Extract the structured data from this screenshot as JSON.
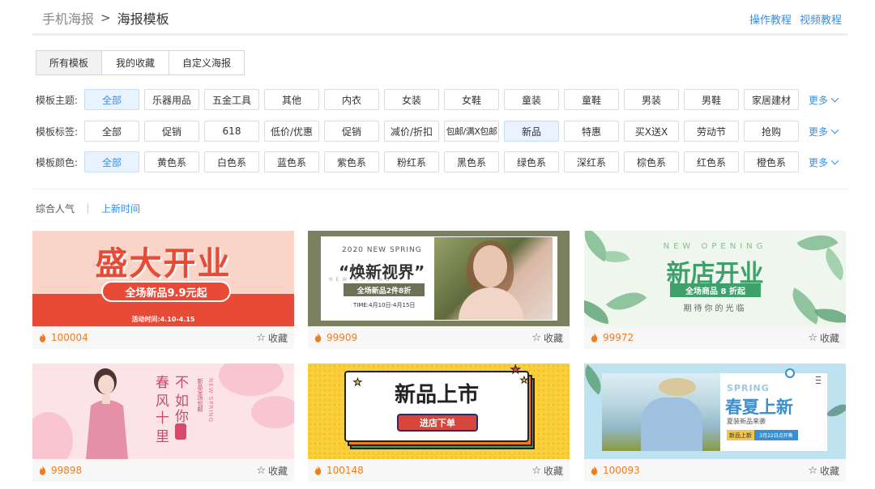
{
  "header": {
    "crumb_parent": "手机海报",
    "crumb_sep": ">",
    "crumb_current": "海报模板",
    "link_tutorial": "操作教程",
    "link_video": "视频教程"
  },
  "tabs": [
    {
      "label": "所有模板",
      "active": true
    },
    {
      "label": "我的收藏",
      "active": false
    },
    {
      "label": "自定义海报",
      "active": false
    }
  ],
  "filters": {
    "more_label": "更多",
    "theme": {
      "label": "模板主题:",
      "options": [
        "全部",
        "乐器用品",
        "五金工具",
        "其他",
        "内衣",
        "女装",
        "女鞋",
        "童装",
        "童鞋",
        "男装",
        "男鞋",
        "家居建材"
      ],
      "selected": "全部"
    },
    "tag": {
      "label": "模板标签:",
      "options": [
        "全部",
        "促销",
        "618",
        "低价/优惠",
        "促销",
        "减价/折扣",
        "包邮/满X包邮",
        "新品",
        "特惠",
        "买X送X",
        "劳动节",
        "抢购"
      ],
      "selected": "新品"
    },
    "color": {
      "label": "模板颜色:",
      "options": [
        "全部",
        "黄色系",
        "白色系",
        "蓝色系",
        "紫色系",
        "粉红系",
        "黑色系",
        "绿色系",
        "深红系",
        "棕色系",
        "红色系",
        "橙色系"
      ],
      "selected": "全部"
    }
  },
  "sort": {
    "popular": "综合人气",
    "newest": "上新时间"
  },
  "fav_label": "收藏",
  "cards": [
    {
      "count": "100004",
      "title": "盛大开业",
      "pill": "全场新品9.9元起",
      "small": "活动时间:4.10-4.15"
    },
    {
      "count": "99909",
      "en": "2020 NEW SPRING",
      "title": "“焕新视界”",
      "sub": "NEW SPRING",
      "badge": "全场新品2件8折",
      "time": "TIME:4月10日-4月15日"
    },
    {
      "count": "99972",
      "en": "NEW OPENING",
      "title": "新店开业",
      "badge": "全场商品 8 折起",
      "sub": "期待你的光临"
    },
    {
      "count": "99898",
      "col1": "春风",
      "col2": "十里",
      "col3": "不如",
      "col4": "你",
      "sv": "新品全场包邮",
      "sv2": "NEW SPRING"
    },
    {
      "count": "100148",
      "title": "新品上市",
      "btn": "进店下单"
    },
    {
      "count": "100093",
      "en": "SPRING",
      "title": "春夏上新",
      "sub": "夏装新品来袭",
      "b1": "新品上新",
      "b2": "3月22日点开售"
    }
  ],
  "colors": {
    "accent": "#3a8ee6",
    "hot": "#f07d1c"
  }
}
